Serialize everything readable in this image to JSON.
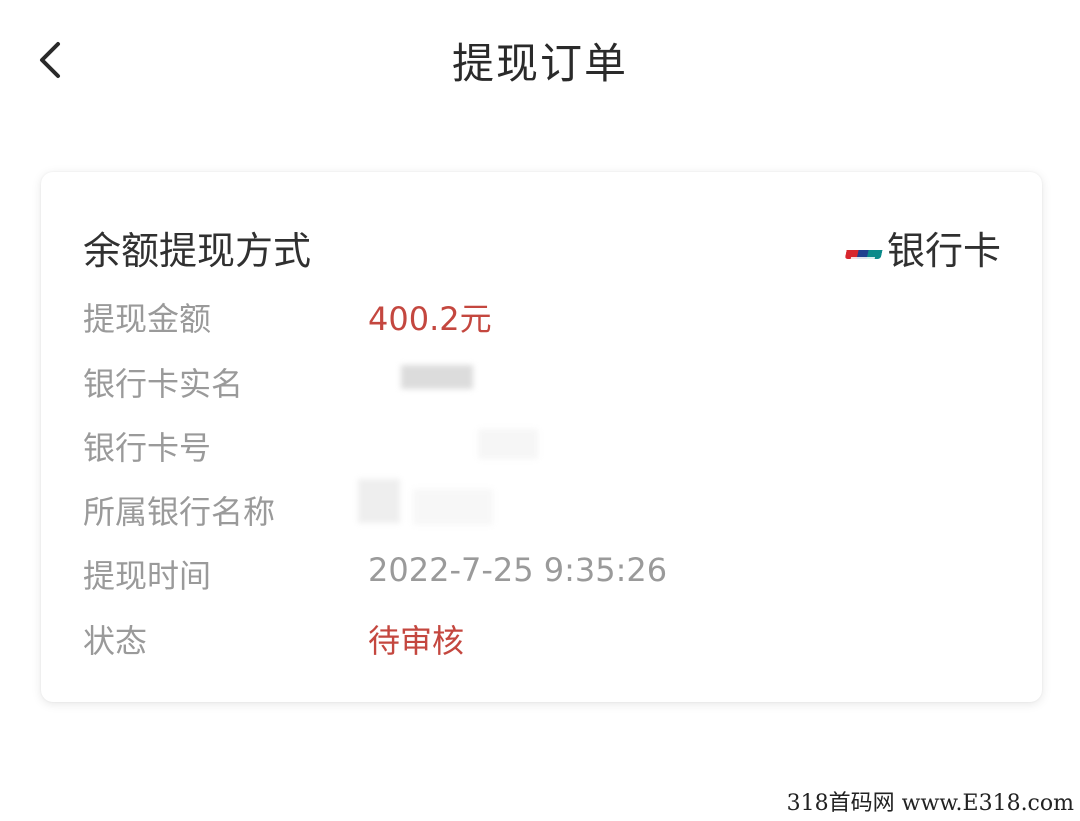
{
  "header": {
    "title": "提现订单"
  },
  "card": {
    "method_label": "余额提现方式",
    "method_value": "银行卡",
    "method_icon": "unionpay-icon",
    "rows": [
      {
        "key": "提现金额",
        "value": "400.2元"
      },
      {
        "key": "银行卡实名",
        "value": ""
      },
      {
        "key": "银行卡号",
        "value": ""
      },
      {
        "key": "所属银行名称",
        "value": ""
      },
      {
        "key": "提现时间",
        "value": "2022-7-25 9:35:26"
      },
      {
        "key": "状态",
        "value": "待审核"
      }
    ]
  },
  "watermark": "318首码网 www.E318.com",
  "colors": {
    "accent_red": "#c4473f",
    "label_gray": "#9a9a9a",
    "text_dark": "#303030"
  }
}
